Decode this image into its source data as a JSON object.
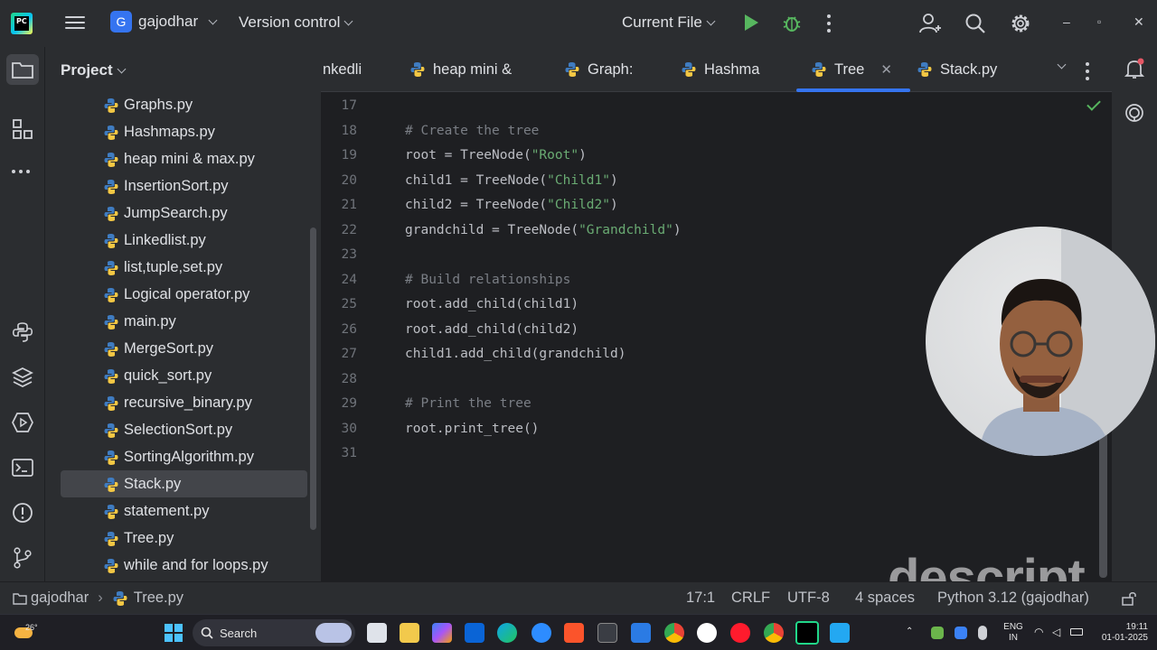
{
  "titlebar": {
    "logo": "PC",
    "project_avatar": "G",
    "project_name": "gajodhar",
    "version_control": "Version control",
    "run_config": "Current File",
    "icons": [
      "main-menu-icon",
      "run-icon",
      "debug-icon",
      "more-icon",
      "add-user-icon",
      "search-icon",
      "settings-icon",
      "minimize-icon",
      "maximize-icon",
      "close-icon"
    ]
  },
  "project_panel": {
    "title": "Project",
    "files": [
      {
        "label": "Graphs.py"
      },
      {
        "label": "Hashmaps.py"
      },
      {
        "label": "heap mini & max.py"
      },
      {
        "label": "InsertionSort.py"
      },
      {
        "label": "JumpSearch.py"
      },
      {
        "label": "Linkedlist.py"
      },
      {
        "label": "list,tuple,set.py"
      },
      {
        "label": "Logical operator.py"
      },
      {
        "label": "main.py"
      },
      {
        "label": "MergeSort.py"
      },
      {
        "label": "quick_sort.py"
      },
      {
        "label": "recursive_binary.py"
      },
      {
        "label": "SelectionSort.py"
      },
      {
        "label": "SortingAlgorithm.py"
      },
      {
        "label": "Stack.py",
        "selected": true
      },
      {
        "label": "statement.py"
      },
      {
        "label": "Tree.py"
      },
      {
        "label": "while and for loops.py"
      }
    ]
  },
  "tabs": [
    {
      "label": "nkedli"
    },
    {
      "label": "heap mini &"
    },
    {
      "label": "Graph:"
    },
    {
      "label": "Hashma"
    },
    {
      "label": "Tree",
      "active": true
    },
    {
      "label": "Stack.py"
    }
  ],
  "editor": {
    "lines": [
      {
        "num": "17",
        "text": ""
      },
      {
        "num": "18",
        "text": "# Create the tree",
        "comment": true
      },
      {
        "num": "19",
        "text": "root = TreeNode(\"Root\")"
      },
      {
        "num": "20",
        "text": "child1 = TreeNode(\"Child1\")"
      },
      {
        "num": "21",
        "text": "child2 = TreeNode(\"Child2\")"
      },
      {
        "num": "22",
        "text": "grandchild = TreeNode(\"Grandchild\")"
      },
      {
        "num": "23",
        "text": ""
      },
      {
        "num": "24",
        "text": "# Build relationships",
        "comment": true
      },
      {
        "num": "25",
        "text": "root.add_child(child1)"
      },
      {
        "num": "26",
        "text": "root.add_child(child2)"
      },
      {
        "num": "27",
        "text": "child1.add_child(grandchild)"
      },
      {
        "num": "28",
        "text": ""
      },
      {
        "num": "29",
        "text": "# Print the tree",
        "comment": true
      },
      {
        "num": "30",
        "text": "root.print_tree()"
      },
      {
        "num": "31",
        "text": ""
      }
    ]
  },
  "watermark": "descript",
  "statusbar": {
    "project": "gajodhar",
    "file": "Tree.py",
    "position": "17:1",
    "line_ending": "CRLF",
    "encoding": "UTF-8",
    "indent": "4 spaces",
    "interpreter": "Python 3.12 (gajodhar)"
  },
  "taskbar": {
    "weather": "26°",
    "search": "Search",
    "lang_top": "ENG",
    "lang_bottom": "IN",
    "time": "19:11",
    "date": "01-01-2025"
  }
}
